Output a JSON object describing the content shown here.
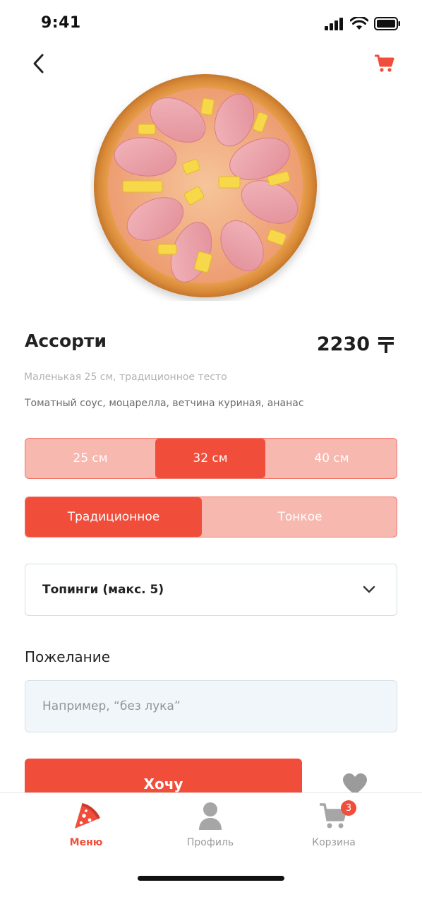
{
  "status_bar": {
    "time": "9:41"
  },
  "nav": {
    "back_icon": "chevron-left-icon",
    "cart_icon": "cart-icon"
  },
  "product": {
    "name": "Ассорти",
    "price": "2230",
    "currency_icon": "tenge-icon",
    "subtitle": "Маленькая 25 см, традиционное тесто",
    "ingredients": "Томатный соус, моцарелла, ветчина куриная, ананас"
  },
  "sizes": {
    "options": [
      "25 см",
      "32 см",
      "40 см"
    ],
    "selected": "32 см"
  },
  "dough": {
    "options": [
      "Традиционное",
      "Тонкое"
    ],
    "selected": "Традиционное"
  },
  "toppings": {
    "label": "Топинги (макс. 5)"
  },
  "wish": {
    "title": "Пожелание",
    "placeholder": "Например, “без лука”"
  },
  "cta": {
    "label": "Хочу"
  },
  "tabbar": {
    "items": [
      {
        "label": "Меню",
        "icon": "pizza-slice-icon",
        "active": true
      },
      {
        "label": "Профиль",
        "icon": "user-icon",
        "active": false
      },
      {
        "label": "Корзина",
        "icon": "cart-icon",
        "active": false,
        "badge": "3"
      }
    ]
  },
  "colors": {
    "accent": "#F04E3B",
    "accent_light": "#F7B8B0",
    "muted": "#9B9B9B"
  }
}
